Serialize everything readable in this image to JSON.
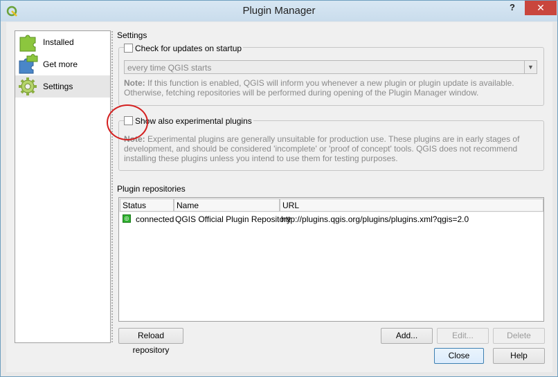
{
  "window": {
    "title": "Plugin Manager",
    "help_glyph": "?",
    "close_glyph": "✕"
  },
  "nav": {
    "items": [
      {
        "label": "Installed",
        "icon": "installed-puzzle-icon",
        "selected": false
      },
      {
        "label": "Get more",
        "icon": "get-more-puzzle-icon",
        "selected": false
      },
      {
        "label": "Settings",
        "icon": "settings-gear-icon",
        "selected": true
      }
    ]
  },
  "settings": {
    "title": "Settings",
    "check_updates": {
      "label": "Check for updates on startup",
      "checked": false,
      "frequency_value": "every time QGIS starts",
      "note_label": "Note:",
      "note_line1": " If this function is enabled, QGIS will inform you whenever a new plugin or plugin update is available.",
      "note_line2": "Otherwise, fetching repositories will be performed during opening of the Plugin Manager window."
    },
    "experimental": {
      "label": "Show also experimental plugins",
      "checked": false,
      "note_label": "Note:",
      "note_line1": " Experimental plugins are generally unsuitable for production use. These plugins are in early stages of",
      "note_line2": "development, and should be considered 'incomplete' or 'proof of concept' tools. QGIS does not recommend",
      "note_line3": "installing these plugins unless you intend to use them for testing purposes."
    }
  },
  "repositories": {
    "title": "Plugin repositories",
    "columns": [
      "Status",
      "Name",
      "URL"
    ],
    "rows": [
      {
        "status": "connected",
        "name": "QGIS Official Plugin Repository",
        "url": "http://plugins.qgis.org/plugins/plugins.xml?qgis=2.0"
      }
    ]
  },
  "buttons": {
    "reload": "Reload repository",
    "add": "Add...",
    "edit": "Edit...",
    "delete": "Delete",
    "close": "Close",
    "help": "Help"
  },
  "colors": {
    "highlight_circle": "#d42020",
    "status_connected": "#2fb02f",
    "titlebar_close": "#c9463d"
  }
}
